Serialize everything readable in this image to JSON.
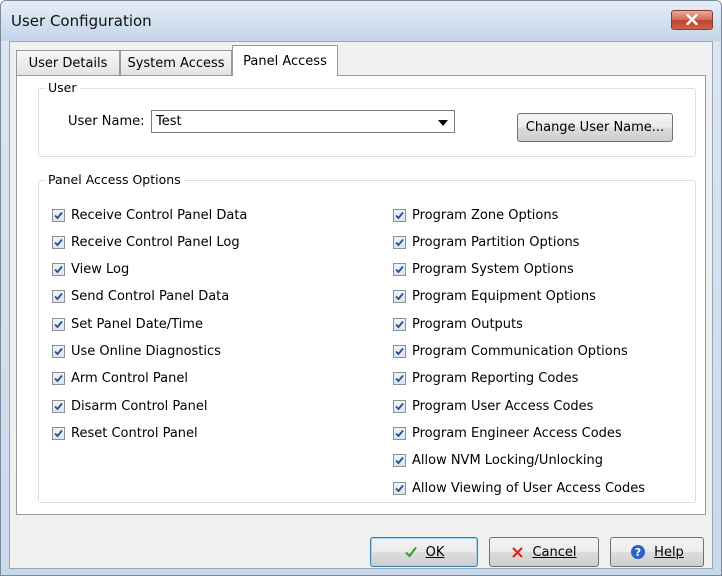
{
  "window": {
    "title": "User Configuration"
  },
  "tabs": [
    {
      "label": "User Details"
    },
    {
      "label": "System Access"
    },
    {
      "label": "Panel Access"
    }
  ],
  "user_group": {
    "title": "User",
    "user_name_label": "User Name:",
    "user_name_value": "Test",
    "change_button": "Change User Name..."
  },
  "options_group": {
    "title": "Panel Access Options",
    "left": [
      {
        "label": "Receive Control Panel Data",
        "checked": true
      },
      {
        "label": "Receive Control Panel Log",
        "checked": true
      },
      {
        "label": "View Log",
        "checked": true
      },
      {
        "label": "Send Control Panel Data",
        "checked": true
      },
      {
        "label": "Set Panel Date/Time",
        "checked": true
      },
      {
        "label": "Use Online Diagnostics",
        "checked": true
      },
      {
        "label": "Arm Control Panel",
        "checked": true
      },
      {
        "label": "Disarm Control Panel",
        "checked": true
      },
      {
        "label": "Reset Control Panel",
        "checked": true
      }
    ],
    "right": [
      {
        "label": "Program Zone Options",
        "checked": true
      },
      {
        "label": "Program Partition Options",
        "checked": true
      },
      {
        "label": "Program System Options",
        "checked": true
      },
      {
        "label": "Program Equipment Options",
        "checked": true
      },
      {
        "label": "Program Outputs",
        "checked": true
      },
      {
        "label": "Program Communication Options",
        "checked": true
      },
      {
        "label": "Program Reporting Codes",
        "checked": true
      },
      {
        "label": "Program User Access Codes",
        "checked": true
      },
      {
        "label": "Program Engineer Access Codes",
        "checked": true
      },
      {
        "label": "Allow NVM Locking/Unlocking",
        "checked": true
      },
      {
        "label": "Allow Viewing of User Access Codes",
        "checked": true
      }
    ]
  },
  "buttons": {
    "ok": "OK",
    "cancel": "Cancel",
    "help": "Help"
  },
  "colors": {
    "checkmark": "#2a4f8f",
    "ok_icon": "#2f9e2f",
    "cancel_icon": "#d42020",
    "help_icon": "#2a63c6"
  }
}
